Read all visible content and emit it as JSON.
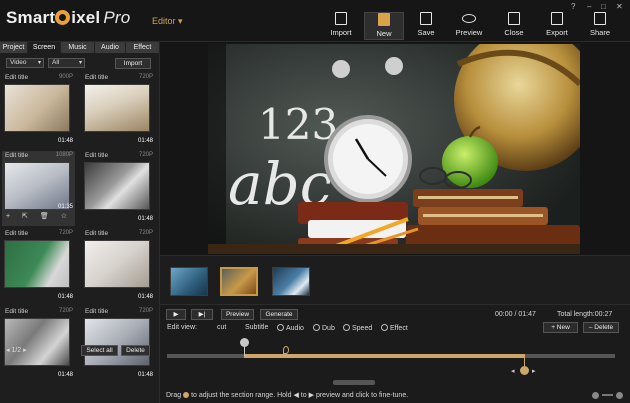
{
  "app": {
    "logo_main": "Smart",
    "logo_rest": "ixel",
    "logo_pro": "Pro",
    "mode": "Editor ▾",
    "window_controls": [
      "?",
      "–",
      "□",
      "✕"
    ]
  },
  "toolbar": [
    {
      "label": "Import",
      "icon": "import-icon"
    },
    {
      "label": "New",
      "icon": "new-icon"
    },
    {
      "label": "Save",
      "icon": "save-icon"
    },
    {
      "label": "Preview",
      "icon": "eye-icon"
    },
    {
      "label": "Close",
      "icon": "close-icon"
    },
    {
      "label": "Export",
      "icon": "export-icon"
    },
    {
      "label": "Share",
      "icon": "share-icon"
    }
  ],
  "tabs": [
    "Project",
    "Screen",
    "Music",
    "Audio",
    "Effect"
  ],
  "filters": {
    "type": "Video",
    "scope": "All",
    "import": "Import"
  },
  "thumbs": [
    {
      "title": "Edit title",
      "res": "900P",
      "dur": "01:48"
    },
    {
      "title": "Edit title",
      "res": "720P",
      "dur": "01:48"
    },
    {
      "title": "Edit title",
      "res": "1080P",
      "dur": "01:35"
    },
    {
      "title": "Edit title",
      "res": "720P",
      "dur": "01:48"
    },
    {
      "title": "Edit title",
      "res": "720P",
      "dur": "01:48"
    },
    {
      "title": "Edit title",
      "res": "720P",
      "dur": "01:48"
    },
    {
      "title": "Edit title",
      "res": "720P",
      "dur": "01:48"
    },
    {
      "title": "Edit title",
      "res": "720P",
      "dur": "01:48"
    }
  ],
  "thumb_actions": [
    "+",
    "⇱",
    "🗑",
    "☆"
  ],
  "pager": "◂ 1/2 ▸",
  "left_buttons": {
    "select_all": "Select all",
    "delete": "Delete"
  },
  "board_text": {
    "numbers": "123",
    "letters": "abc"
  },
  "playback": {
    "play": "▶",
    "step": "▶|",
    "preview": "Preview",
    "generate": "Generate",
    "time": "00:00 / 01:47",
    "total": "Total length:00:27"
  },
  "edit_view": {
    "label": "Edit view:",
    "cut": "cut",
    "subtitle": "Subtitle",
    "options": [
      "Audio",
      "Dub",
      "Speed",
      "Effect"
    ]
  },
  "actions": {
    "new": "+ New",
    "delete": "– Delete"
  },
  "hint": {
    "part1": "Drag",
    "part2": "to  adjust the section range. Hold",
    "part3": "to",
    "part4": "preview and click to  fine-tune."
  },
  "colors": {
    "accent": "#cda76a",
    "bg": "#1b1b1b"
  }
}
